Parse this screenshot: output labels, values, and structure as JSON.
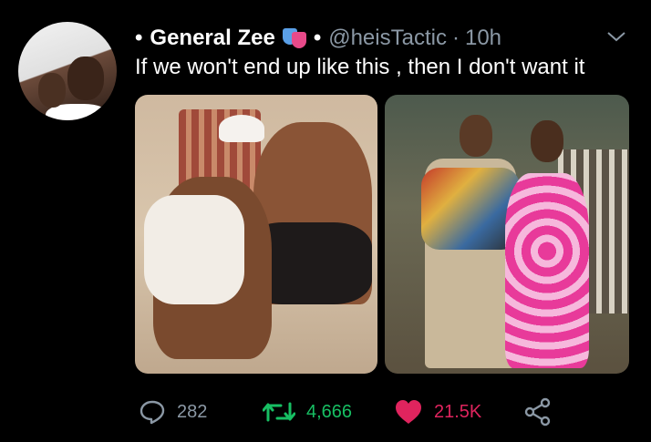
{
  "tweet": {
    "display_name": "General Zee",
    "name_emoji": "performing-arts-icon",
    "handle": "@heisTactic",
    "separator": "·",
    "time": "10h",
    "text": "If we won't end up like this , then I don't want it"
  },
  "actions": {
    "replies": "282",
    "retweets": "4,666",
    "likes": "21.5K"
  },
  "colors": {
    "background": "#000000",
    "muted": "#8b98a5",
    "retweet": "#17bf63",
    "like": "#e0245e"
  }
}
